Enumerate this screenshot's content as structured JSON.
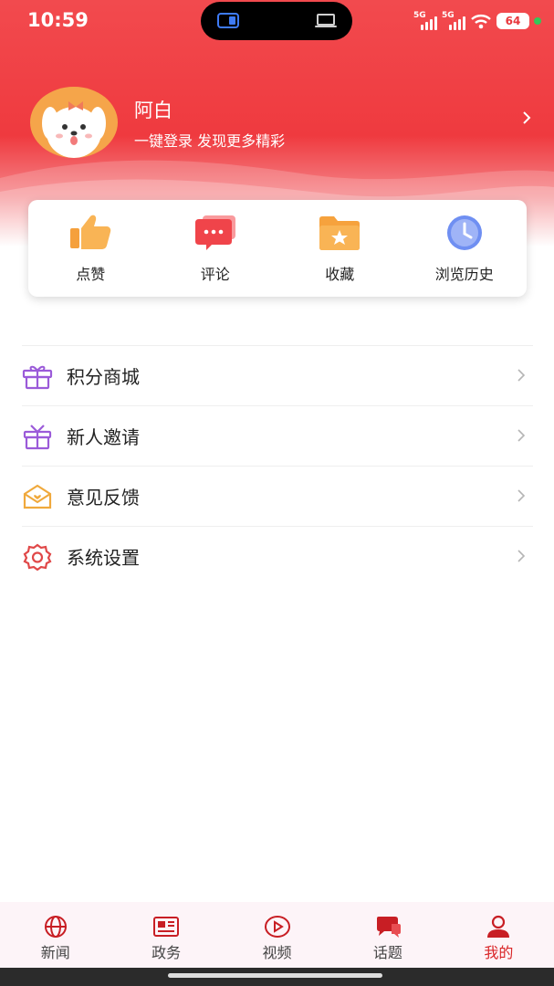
{
  "status_bar": {
    "time": "10:59",
    "signal_1": "5G",
    "signal_2": "5G",
    "battery": "64"
  },
  "profile": {
    "name": "阿白",
    "login_hint": "一键登录  发现更多精彩"
  },
  "quick_actions": [
    {
      "label": "点赞",
      "icon": "thumbs-up-icon",
      "color": "#f5a03c"
    },
    {
      "label": "评论",
      "icon": "comment-icon",
      "color": "#f0444a"
    },
    {
      "label": "收藏",
      "icon": "favorite-folder-icon",
      "color": "#f6a23d"
    },
    {
      "label": "浏览历史",
      "icon": "history-clock-icon",
      "color": "#6f8ff2"
    }
  ],
  "menu": [
    {
      "label": "积分商城",
      "icon": "gift-box-icon",
      "color": "#9b5bd9"
    },
    {
      "label": "新人邀请",
      "icon": "gift-icon",
      "color": "#9b5bd9"
    },
    {
      "label": "意见反馈",
      "icon": "mail-feedback-icon",
      "color": "#f0a93c"
    },
    {
      "label": "系统设置",
      "icon": "gear-icon",
      "color": "#e04848"
    }
  ],
  "tabbar": [
    {
      "label": "新闻",
      "icon": "globe-icon",
      "active": false
    },
    {
      "label": "政务",
      "icon": "newspaper-icon",
      "active": false
    },
    {
      "label": "视频",
      "icon": "play-icon",
      "active": false
    },
    {
      "label": "话题",
      "icon": "chat-bubbles-icon",
      "active": false
    },
    {
      "label": "我的",
      "icon": "user-icon",
      "active": true
    }
  ],
  "colors": {
    "brand_red": "#ef3a3f",
    "tab_active": "#d92527"
  }
}
